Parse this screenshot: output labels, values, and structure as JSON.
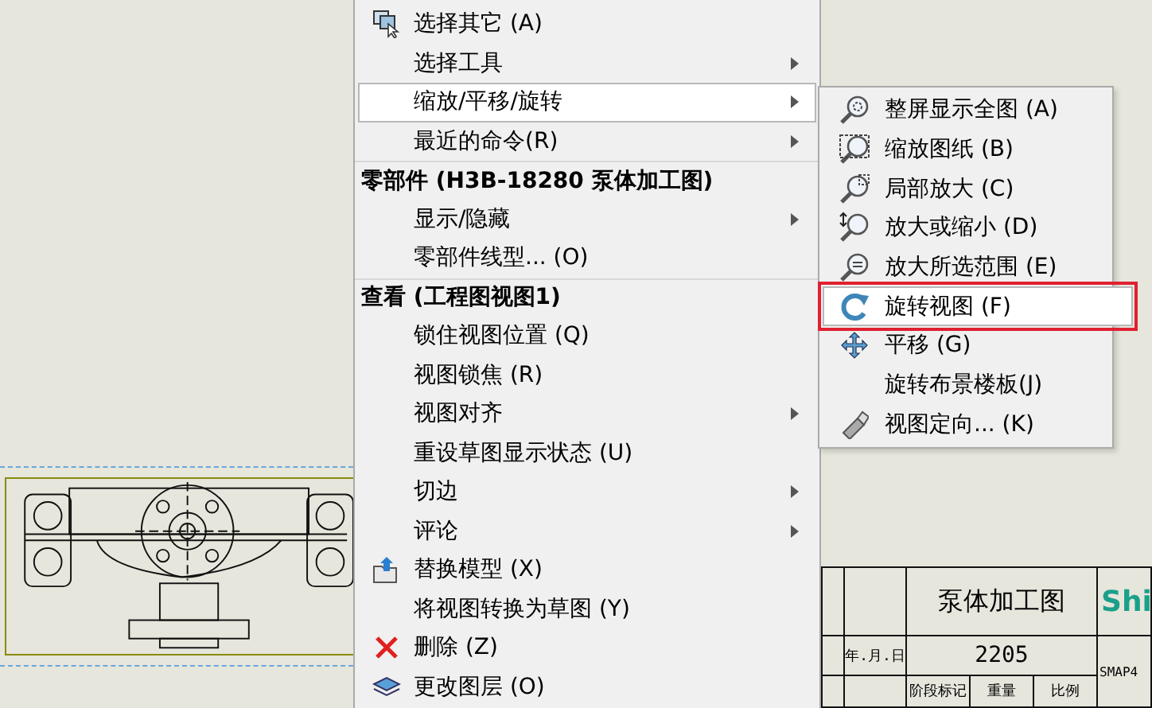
{
  "menu": {
    "items": [
      {
        "kind": "item",
        "label": "选择其它 (A)",
        "submenu": false,
        "selected": false
      },
      {
        "kind": "item",
        "label": "选择工具",
        "submenu": true,
        "selected": false
      },
      {
        "kind": "item",
        "label": "缩放/平移/旋转",
        "submenu": true,
        "selected": true
      },
      {
        "kind": "item",
        "label": "最近的命令(R)",
        "submenu": true,
        "selected": false
      },
      {
        "kind": "header",
        "label": "零部件 (H3B-18280 泵体加工图)"
      },
      {
        "kind": "item",
        "label": "显示/隐藏",
        "submenu": true,
        "selected": false
      },
      {
        "kind": "item",
        "label": "零部件线型... (O)",
        "submenu": false,
        "selected": false
      },
      {
        "kind": "header",
        "label": "查看 (工程图视图1)"
      },
      {
        "kind": "item",
        "label": "锁住视图位置 (Q)",
        "submenu": false,
        "selected": false
      },
      {
        "kind": "item",
        "label": "视图锁焦 (R)",
        "submenu": false,
        "selected": false
      },
      {
        "kind": "item",
        "label": "视图对齐",
        "submenu": true,
        "selected": false
      },
      {
        "kind": "item",
        "label": "重设草图显示状态 (U)",
        "submenu": false,
        "selected": false
      },
      {
        "kind": "item",
        "label": "切边",
        "submenu": true,
        "selected": false
      },
      {
        "kind": "item",
        "label": "评论",
        "submenu": true,
        "selected": false
      },
      {
        "kind": "item",
        "label": "替换模型 (X)",
        "submenu": false,
        "selected": false
      },
      {
        "kind": "item",
        "label": "将视图转换为草图 (Y)",
        "submenu": false,
        "selected": false
      },
      {
        "kind": "item",
        "label": "删除 (Z)",
        "submenu": false,
        "selected": false
      },
      {
        "kind": "item",
        "label": "更改图层 (O)",
        "submenu": false,
        "selected": false
      }
    ]
  },
  "submenu": {
    "items": [
      {
        "label": "整屏显示全图 (A)",
        "selected": false,
        "outlined": false
      },
      {
        "label": "缩放图纸 (B)",
        "selected": false,
        "outlined": false
      },
      {
        "label": "局部放大 (C)",
        "selected": false,
        "outlined": false
      },
      {
        "label": "放大或缩小 (D)",
        "selected": false,
        "outlined": false
      },
      {
        "label": "放大所选范围 (E)",
        "selected": false,
        "outlined": false
      },
      {
        "label": "旋转视图 (F)",
        "selected": true,
        "outlined": true
      },
      {
        "label": "平移 (G)",
        "selected": false,
        "outlined": false
      },
      {
        "label": "旋转布景楼板(J)",
        "selected": false,
        "outlined": false
      },
      {
        "label": "视图定向... (K)",
        "selected": false,
        "outlined": false
      }
    ]
  },
  "title_block": {
    "title": "泵体加工图",
    "number": "2205",
    "logo": "Shi",
    "code": "SMAP4",
    "date": "年.月.日",
    "stage": "阶段标记",
    "weight": "重量",
    "scale": "比例"
  }
}
